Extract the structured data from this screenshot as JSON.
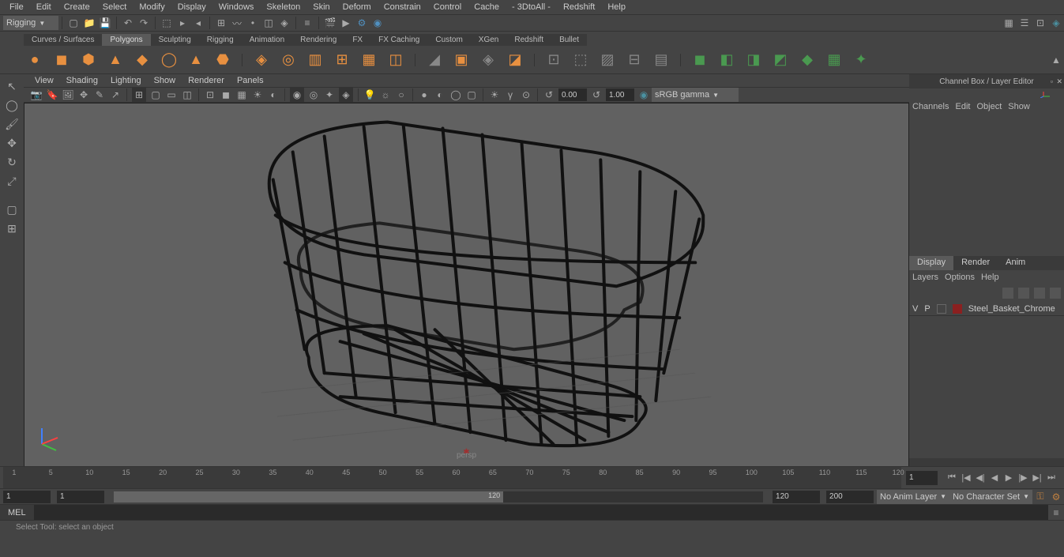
{
  "menubar": [
    "File",
    "Edit",
    "Create",
    "Select",
    "Modify",
    "Display",
    "Windows",
    "Skeleton",
    "Skin",
    "Deform",
    "Constrain",
    "Control",
    "Cache",
    "- 3DtoAll -",
    "Redshift",
    "Help"
  ],
  "workspace": "Rigging",
  "shelfTabs": [
    "Curves / Surfaces",
    "Polygons",
    "Sculpting",
    "Rigging",
    "Animation",
    "Rendering",
    "FX",
    "FX Caching",
    "Custom",
    "XGen",
    "Redshift",
    "Bullet"
  ],
  "activeShelfTab": "Polygons",
  "viewportMenu": [
    "View",
    "Shading",
    "Lighting",
    "Show",
    "Renderer",
    "Panels"
  ],
  "vpField1": "0.00",
  "vpField2": "1.00",
  "colorMode": "sRGB gamma",
  "cameraLabel": "persp",
  "channelBox": {
    "title": "Channel Box / Layer Editor",
    "tabs": [
      "Channels",
      "Edit",
      "Object",
      "Show"
    ],
    "bottomTabs": [
      "Display",
      "Render",
      "Anim"
    ],
    "activeBottomTab": "Display",
    "layerTabs": [
      "Layers",
      "Options",
      "Help"
    ],
    "layerName": "Steel_Basket_Chrome",
    "layerV": "V",
    "layerP": "P"
  },
  "timeTicks": [
    "1",
    "5",
    "10",
    "15",
    "20",
    "25",
    "30",
    "35",
    "40",
    "45",
    "50",
    "55",
    "60",
    "65",
    "70",
    "75",
    "80",
    "85",
    "90",
    "95",
    "100",
    "105",
    "110",
    "115",
    "120"
  ],
  "timeCurrent": "1",
  "rangeStart": "1",
  "rangeInnerStart": "1",
  "rangeInnerEnd": "120",
  "rangeEnd1": "120",
  "rangeEnd2": "200",
  "animLayer": "No Anim Layer",
  "charSet": "No Character Set",
  "cmdLang": "MEL",
  "helpText": "Select Tool: select an object"
}
